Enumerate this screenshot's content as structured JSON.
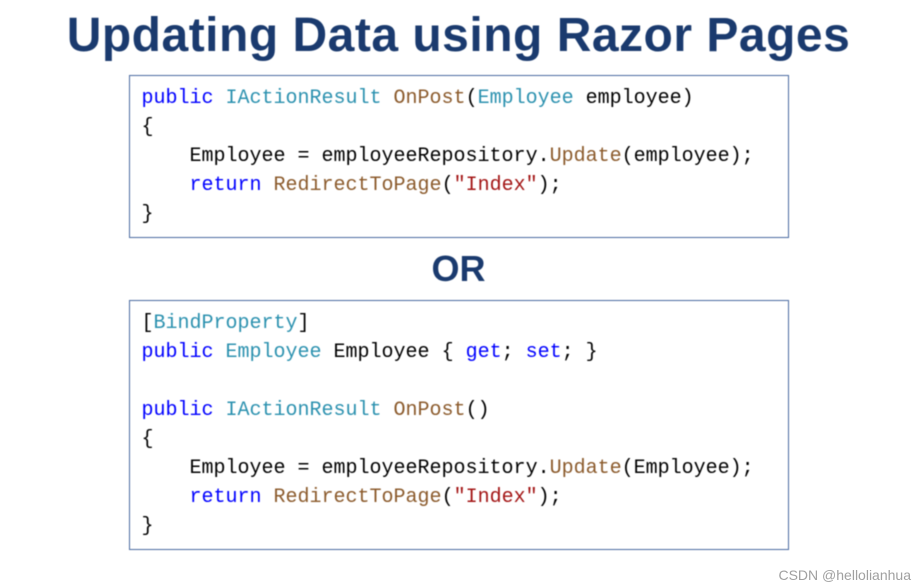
{
  "title": "Updating Data using Razor Pages",
  "or_label": "OR",
  "watermark": "CSDN @hellolianhua",
  "code1": {
    "tokens": [
      {
        "t": "public ",
        "c": "kw"
      },
      {
        "t": "IActionResult ",
        "c": "type"
      },
      {
        "t": "OnPost",
        "c": "meth"
      },
      {
        "t": "(",
        "c": "plain"
      },
      {
        "t": "Employee ",
        "c": "type"
      },
      {
        "t": "employee",
        "c": "plain"
      },
      {
        "t": ")",
        "c": "plain"
      },
      {
        "t": "\n",
        "c": "nl"
      },
      {
        "t": "{",
        "c": "plain"
      },
      {
        "t": "\n",
        "c": "nl"
      },
      {
        "t": "    Employee = employeeRepository.",
        "c": "plain"
      },
      {
        "t": "Update",
        "c": "meth"
      },
      {
        "t": "(employee);",
        "c": "plain"
      },
      {
        "t": "\n",
        "c": "nl"
      },
      {
        "t": "    ",
        "c": "plain"
      },
      {
        "t": "return ",
        "c": "kw"
      },
      {
        "t": "RedirectToPage",
        "c": "meth"
      },
      {
        "t": "(",
        "c": "plain"
      },
      {
        "t": "\"Index\"",
        "c": "str"
      },
      {
        "t": ");",
        "c": "plain"
      },
      {
        "t": "\n",
        "c": "nl"
      },
      {
        "t": "}",
        "c": "plain"
      }
    ]
  },
  "code2": {
    "tokens": [
      {
        "t": "[",
        "c": "plain"
      },
      {
        "t": "BindProperty",
        "c": "type"
      },
      {
        "t": "]",
        "c": "plain"
      },
      {
        "t": "\n",
        "c": "nl"
      },
      {
        "t": "public ",
        "c": "kw"
      },
      {
        "t": "Employee ",
        "c": "type"
      },
      {
        "t": "Employee { ",
        "c": "plain"
      },
      {
        "t": "get",
        "c": "kw"
      },
      {
        "t": "; ",
        "c": "plain"
      },
      {
        "t": "set",
        "c": "kw"
      },
      {
        "t": "; }",
        "c": "plain"
      },
      {
        "t": "\n",
        "c": "nl"
      },
      {
        "t": "\n",
        "c": "nl"
      },
      {
        "t": "public ",
        "c": "kw"
      },
      {
        "t": "IActionResult ",
        "c": "type"
      },
      {
        "t": "OnPost",
        "c": "meth"
      },
      {
        "t": "()",
        "c": "plain"
      },
      {
        "t": "\n",
        "c": "nl"
      },
      {
        "t": "{",
        "c": "plain"
      },
      {
        "t": "\n",
        "c": "nl"
      },
      {
        "t": "    Employee = employeeRepository.",
        "c": "plain"
      },
      {
        "t": "Update",
        "c": "meth"
      },
      {
        "t": "(Employee);",
        "c": "plain"
      },
      {
        "t": "\n",
        "c": "nl"
      },
      {
        "t": "    ",
        "c": "plain"
      },
      {
        "t": "return ",
        "c": "kw"
      },
      {
        "t": "RedirectToPage",
        "c": "meth"
      },
      {
        "t": "(",
        "c": "plain"
      },
      {
        "t": "\"Index\"",
        "c": "str"
      },
      {
        "t": ");",
        "c": "plain"
      },
      {
        "t": "\n",
        "c": "nl"
      },
      {
        "t": "}",
        "c": "plain"
      }
    ]
  }
}
